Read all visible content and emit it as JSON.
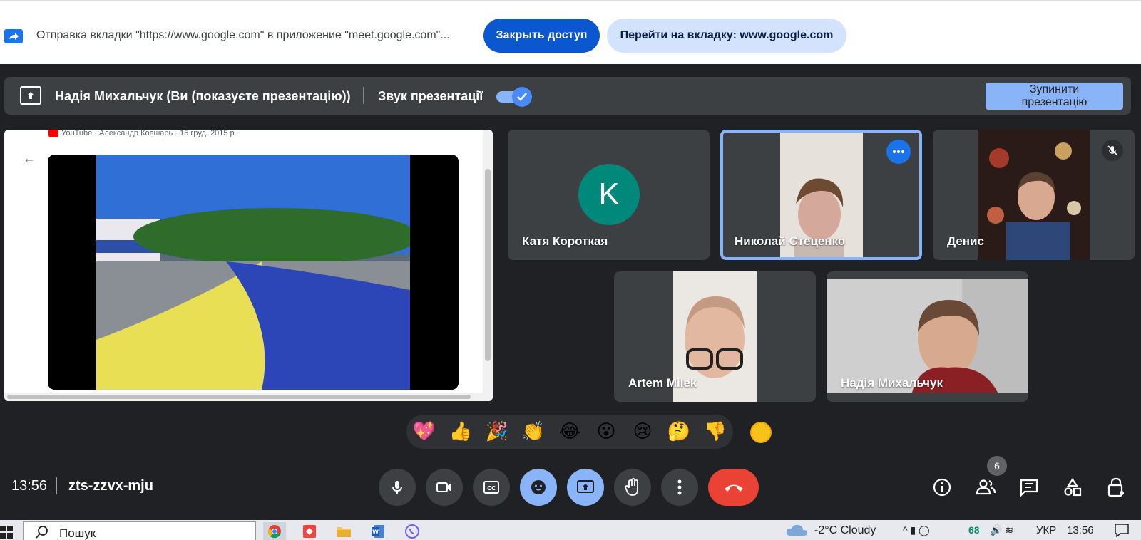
{
  "share_bar": {
    "message": "Отправка вкладки \"https://www.google.com\" в приложение \"meet.google.com\"...",
    "stop_access_label": "Закрыть доступ",
    "goto_tab_label": "Перейти на вкладку: www.google.com"
  },
  "presentation_bar": {
    "presenter_text": "Надія Михальчук (Ви (показуєте презентацію))",
    "sound_label": "Звук презентації",
    "sound_enabled": true,
    "stop_button_label": "Зупинити\nпрезентацію"
  },
  "shared_screen": {
    "source_label": "YouTube · Александр Ковшарь · 15 груд. 2015 р."
  },
  "participants": [
    {
      "name": "Катя Короткая",
      "avatar_letter": "K",
      "avatar_color": "#00897b"
    },
    {
      "name": "Николай Стеценко",
      "active_speaker": true
    },
    {
      "name": "Денис",
      "muted": true
    },
    {
      "name": "Artem Milek"
    },
    {
      "name": "Надія Михальчук"
    }
  ],
  "reactions": [
    "💖",
    "👍",
    "🎉",
    "👏",
    "😂",
    "😮",
    "😢",
    "🤔",
    "👎"
  ],
  "meeting": {
    "time": "13:56",
    "code": "zts-zzvx-mju",
    "people_count": "6"
  },
  "taskbar": {
    "search_placeholder": "Пошук",
    "weather": "-2°C  Cloudy",
    "battery": "68",
    "language": "УКР",
    "clock": "13:56"
  },
  "colors": {
    "meet_bg": "#202124",
    "accent_blue": "#8ab4f8",
    "hangup_red": "#ea4335",
    "share_primary": "#0b57d0"
  }
}
